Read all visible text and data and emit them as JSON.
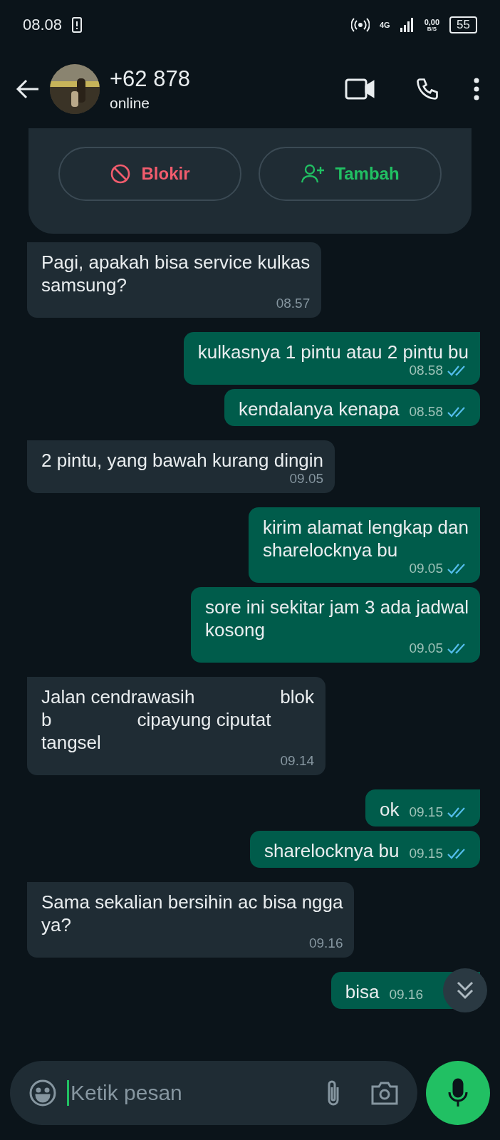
{
  "status_bar": {
    "time": "08.08",
    "network": "4G",
    "speed": "0,00",
    "speed_unit": "B/S",
    "battery": "55"
  },
  "header": {
    "title": "+62 878",
    "subtitle": "online"
  },
  "contact_card": {
    "buttons": [
      {
        "label": "Blokir",
        "kind": "block"
      },
      {
        "label": "Tambah",
        "kind": "add"
      }
    ]
  },
  "messages": [
    {
      "kind": "in",
      "lines": [
        [
          "Pagi, apakah bisa service kulkas"
        ],
        [
          "samsung?"
        ]
      ],
      "time": "08.57"
    },
    {
      "kind": "out",
      "lines": [
        [
          "kulkasnya 1 pintu atau 2 pintu bu"
        ]
      ],
      "time": "08.58",
      "read": true
    },
    {
      "kind": "out",
      "lines": [
        [
          "kendalanya kenapa"
        ]
      ],
      "time": "08.58",
      "read": true
    },
    {
      "kind": "in",
      "lines": [
        [
          "2 pintu, yang bawah kurang dingin"
        ]
      ],
      "time": "09.05"
    },
    {
      "kind": "out",
      "lines": [
        [
          "kirim alamat lengkap dan"
        ],
        [
          "sharelocknya bu"
        ]
      ],
      "time": "09.05",
      "read": true
    },
    {
      "kind": "out",
      "lines": [
        [
          "sore ini sekitar jam 3 ada jadwal"
        ],
        [
          "kosong"
        ]
      ],
      "time": "09.05",
      "read": true
    },
    {
      "kind": "in",
      "lines": [
        [
          "Jalan cendrawasih",
          "blok"
        ],
        [
          "b",
          "cipayung ciputat"
        ],
        [
          "tangsel"
        ]
      ],
      "time": "09.14"
    },
    {
      "kind": "out",
      "lines": [
        [
          "ok"
        ]
      ],
      "time": "09.15",
      "read": true
    },
    {
      "kind": "out",
      "lines": [
        [
          "sharelocknya bu"
        ]
      ],
      "time": "09.15",
      "read": true
    },
    {
      "kind": "in",
      "lines": [
        [
          "Sama sekalian bersihin ac bisa ngga"
        ],
        [
          "ya?"
        ]
      ],
      "time": "09.16"
    },
    {
      "kind": "out",
      "lines": [
        [
          "bisa"
        ]
      ],
      "time": "09.16"
    }
  ],
  "composer": {
    "placeholder": "Ketik pesan"
  }
}
